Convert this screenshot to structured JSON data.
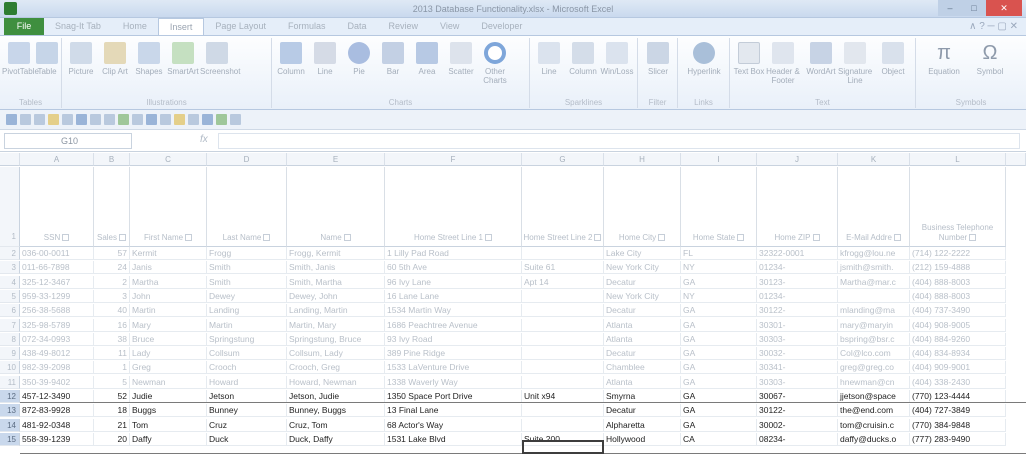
{
  "window": {
    "title": "2013 Database Functionality.xlsx - Microsoft Excel",
    "app_icon": "excel-icon",
    "controls": {
      "minimize": "–",
      "maximize": "□",
      "close": "✕"
    }
  },
  "ribbon": {
    "file_tab": "File",
    "tabs": [
      "Snag-It Tab",
      "Home",
      "Insert",
      "Page Layout",
      "Formulas",
      "Data",
      "Review",
      "View",
      "Developer"
    ],
    "active_tab": "Insert",
    "right_icons": "∧ ? ─ ▢ ✕",
    "groups": [
      {
        "label": "Tables",
        "buttons": [
          "PivotTable",
          "Table"
        ]
      },
      {
        "label": "Illustrations",
        "buttons": [
          "Picture",
          "Clip Art",
          "Shapes",
          "SmartArt",
          "Screenshot"
        ]
      },
      {
        "label": "Charts",
        "buttons": [
          "Column",
          "Line",
          "Pie",
          "Bar",
          "Area",
          "Scatter",
          "Other Charts"
        ]
      },
      {
        "label": "Sparklines",
        "buttons": [
          "Line",
          "Column",
          "Win/Loss"
        ]
      },
      {
        "label": "Filter",
        "buttons": [
          "Slicer"
        ]
      },
      {
        "label": "Links",
        "buttons": [
          "Hyperlink"
        ]
      },
      {
        "label": "Text",
        "buttons": [
          "Text Box",
          "Header & Footer",
          "WordArt",
          "Signature Line",
          "Object"
        ]
      },
      {
        "label": "Symbols",
        "buttons": [
          "Equation",
          "Symbol"
        ]
      }
    ]
  },
  "formula_bar": {
    "name_box": "G10",
    "fx": "fx",
    "value": ""
  },
  "columns": [
    "A",
    "B",
    "C",
    "D",
    "E",
    "F",
    "G",
    "H",
    "I",
    "J",
    "K",
    "L"
  ],
  "headers": [
    "SSN",
    "Sales",
    "First Name",
    "Last Name",
    "Name",
    "Home Street Line 1",
    "Home Street Line 2",
    "Home City",
    "Home State",
    "Home ZIP",
    "E-Mail Addre",
    "Business Telephone Number"
  ],
  "rows": [
    {
      "n": "2",
      "cells": [
        "036-00-0011",
        "57",
        "Kermit",
        "Frogg",
        "Frogg, Kermit",
        "1 Lilly Pad Road",
        "",
        "Lake City",
        "FL",
        "32322-0001",
        "kfrogg@lou.ne",
        "(714) 122-2222"
      ]
    },
    {
      "n": "3",
      "cells": [
        "011-66-7898",
        "24",
        "Janis",
        "Smith",
        "Smith, Janis",
        "60 5th Ave",
        "Suite 61",
        "New York City",
        "NY",
        "01234-",
        "jsmith@smith.",
        "(212) 159-4888"
      ]
    },
    {
      "n": "4",
      "cells": [
        "325-12-3467",
        "2",
        "Martha",
        "Smith",
        "Smith, Martha",
        "96 Ivy Lane",
        "Apt 14",
        "Decatur",
        "GA",
        "30123-",
        "Martha@mar.c",
        "(404) 888-8003"
      ]
    },
    {
      "n": "5",
      "cells": [
        "959-33-1299",
        "3",
        "John",
        "Dewey",
        "Dewey, John",
        "16 Lane Lane",
        "",
        "New York City",
        "NY",
        "01234-",
        "",
        "(404) 888-8003"
      ]
    },
    {
      "n": "6",
      "cells": [
        "256-38-5688",
        "40",
        "Martin",
        "Landing",
        "Landing, Martin",
        "1534 Martin Way",
        "",
        "Decatur",
        "GA",
        "30122-",
        "mlanding@ma",
        "(404) 737-3490"
      ]
    },
    {
      "n": "7",
      "cells": [
        "325-98-5789",
        "16",
        "Mary",
        "Martin",
        "Martin, Mary",
        "1686 Peachtree Avenue",
        "",
        "Atlanta",
        "GA",
        "30301-",
        "mary@maryin",
        "(404) 908-9005"
      ]
    },
    {
      "n": "8",
      "cells": [
        "072-34-0993",
        "38",
        "Bruce",
        "Springstung",
        "Springstung, Bruce",
        "93 Ivy Road",
        "",
        "Atlanta",
        "GA",
        "30303-",
        "bspring@bsr.c",
        "(404) 884-9260"
      ]
    },
    {
      "n": "9",
      "cells": [
        "438-49-8012",
        "11",
        "Lady",
        "Collsum",
        "Collsum, Lady",
        "389 Pine Ridge",
        "",
        "Decatur",
        "GA",
        "30032-",
        "Col@lco.com",
        "(404) 834-8934"
      ]
    },
    {
      "n": "10",
      "cells": [
        "982-39-2098",
        "1",
        "Greg",
        "Crooch",
        "Crooch, Greg",
        "1533 LaVenture Drive",
        "",
        "Chamblee",
        "GA",
        "30341-",
        "greg@greg.co",
        "(404) 909-9001"
      ]
    },
    {
      "n": "11",
      "cells": [
        "350-39-9402",
        "5",
        "Newman",
        "Howard",
        "Howard, Newman",
        "1338 Waverly Way",
        "",
        "Atlanta",
        "GA",
        "30303-",
        "hnewman@cn",
        "(404) 338-2430"
      ]
    },
    {
      "n": "12",
      "cells": [
        "457-12-3490",
        "52",
        "Judie",
        "Jetson",
        "Jetson, Judie",
        "1350 Space Port Drive",
        "Unit x94",
        "Smyrna",
        "GA",
        "30067-",
        "jjetson@space",
        "(770) 123-4444"
      ]
    },
    {
      "n": "13",
      "cells": [
        "872-83-9928",
        "18",
        "Buggs",
        "Bunney",
        "Bunney, Buggs",
        "13 Final Lane",
        "",
        "Decatur",
        "GA",
        "30122-",
        "the@end.com",
        "(404) 727-3849"
      ]
    },
    {
      "n": "14",
      "cells": [
        "481-92-0348",
        "21",
        "Tom",
        "Cruz",
        "Cruz, Tom",
        "68 Actor's Way",
        "",
        "Alpharetta",
        "GA",
        "30002-",
        "tom@cruisin.c",
        "(770) 384-9848"
      ]
    },
    {
      "n": "15",
      "cells": [
        "558-39-1239",
        "20",
        "Daffy",
        "Duck",
        "Duck, Daffy",
        "1531 Lake Blvd",
        "Suite 200",
        "Hollywood",
        "CA",
        "08234-",
        "daffy@ducks.o",
        "(777) 283-9490"
      ]
    }
  ]
}
